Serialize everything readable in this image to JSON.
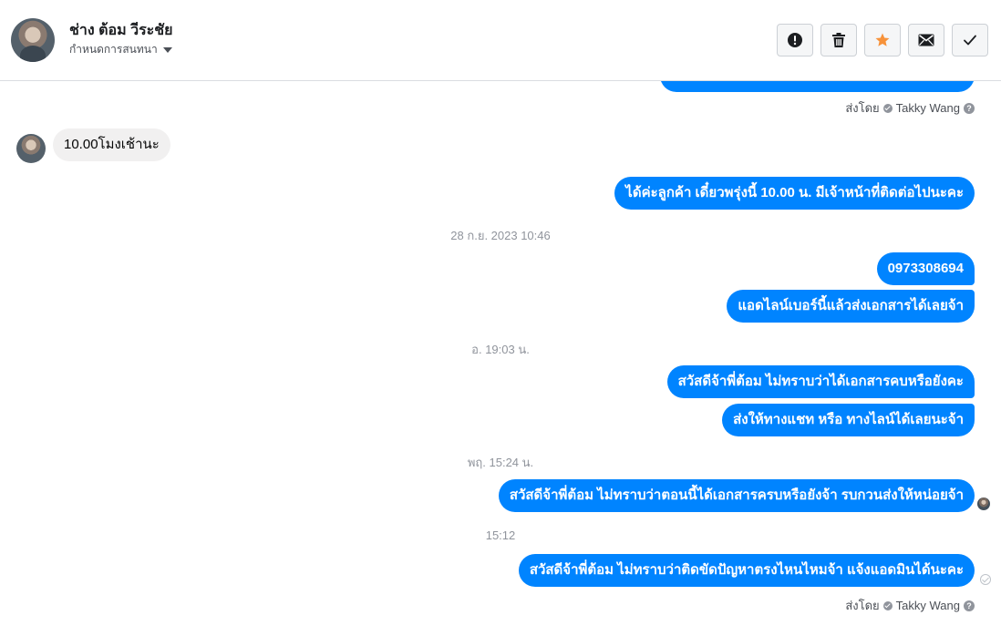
{
  "header": {
    "contact_name": "ช่าง ต้อม วีระชัย",
    "assign_label": "กำหนดการสนทนา",
    "actions": [
      {
        "name": "mark-spam-button",
        "icon": "exclamation-circle-icon"
      },
      {
        "name": "delete-button",
        "icon": "trash-icon"
      },
      {
        "name": "star-button",
        "icon": "star-icon"
      },
      {
        "name": "mark-unread-button",
        "icon": "envelope-icon"
      },
      {
        "name": "mark-done-button",
        "icon": "checkmark-icon"
      }
    ]
  },
  "colors": {
    "bubble_out": "#0084ff",
    "bubble_in": "#f1f0f0",
    "star": "#f7923a",
    "timestamp": "#90949c"
  },
  "messages": {
    "sent_by_top": {
      "prefix": "ส่งโดย",
      "agent": "Takky Wang"
    },
    "in_1": "10.00โมงเช้านะ",
    "out_1": "ได้ค่ะลูกค้า เดี๋ยวพรุ่งนี้ 10.00 น. มีเจ้าหน้าที่ติดต่อไปนะคะ",
    "ts_1": "28 ก.ย. 2023 10:46",
    "out_2": "0973308694",
    "out_3": "แอดไลน์เบอร์นี้แล้วส่งเอกสารได้เลยจ้า",
    "ts_2": "อ. 19:03 น.",
    "out_4": "สวัสดีจ้าพี่ต้อม ไม่ทราบว่าได้เอกสารคบหรือยังคะ",
    "out_5": "ส่งให้ทางแชท หรือ ทางไลน์ได้เลยนะจ้า",
    "ts_3": "พฤ. 15:24 น.",
    "out_6": "สวัสดีจ้าพี่ต้อม ไม่ทราบว่าตอนนี้ได้เอกสารครบหรือยังจ้า รบกวนส่งให้หน่อยจ้า",
    "ts_4": "15:12",
    "out_7": "สวัสดีจ้าพี่ต้อม ไม่ทราบว่าติดขัดปัญหาตรงไหนไหมจ้า แจ้งแอดมินได้นะคะ",
    "sent_by_bottom": {
      "prefix": "ส่งโดย",
      "agent": "Takky Wang"
    }
  }
}
